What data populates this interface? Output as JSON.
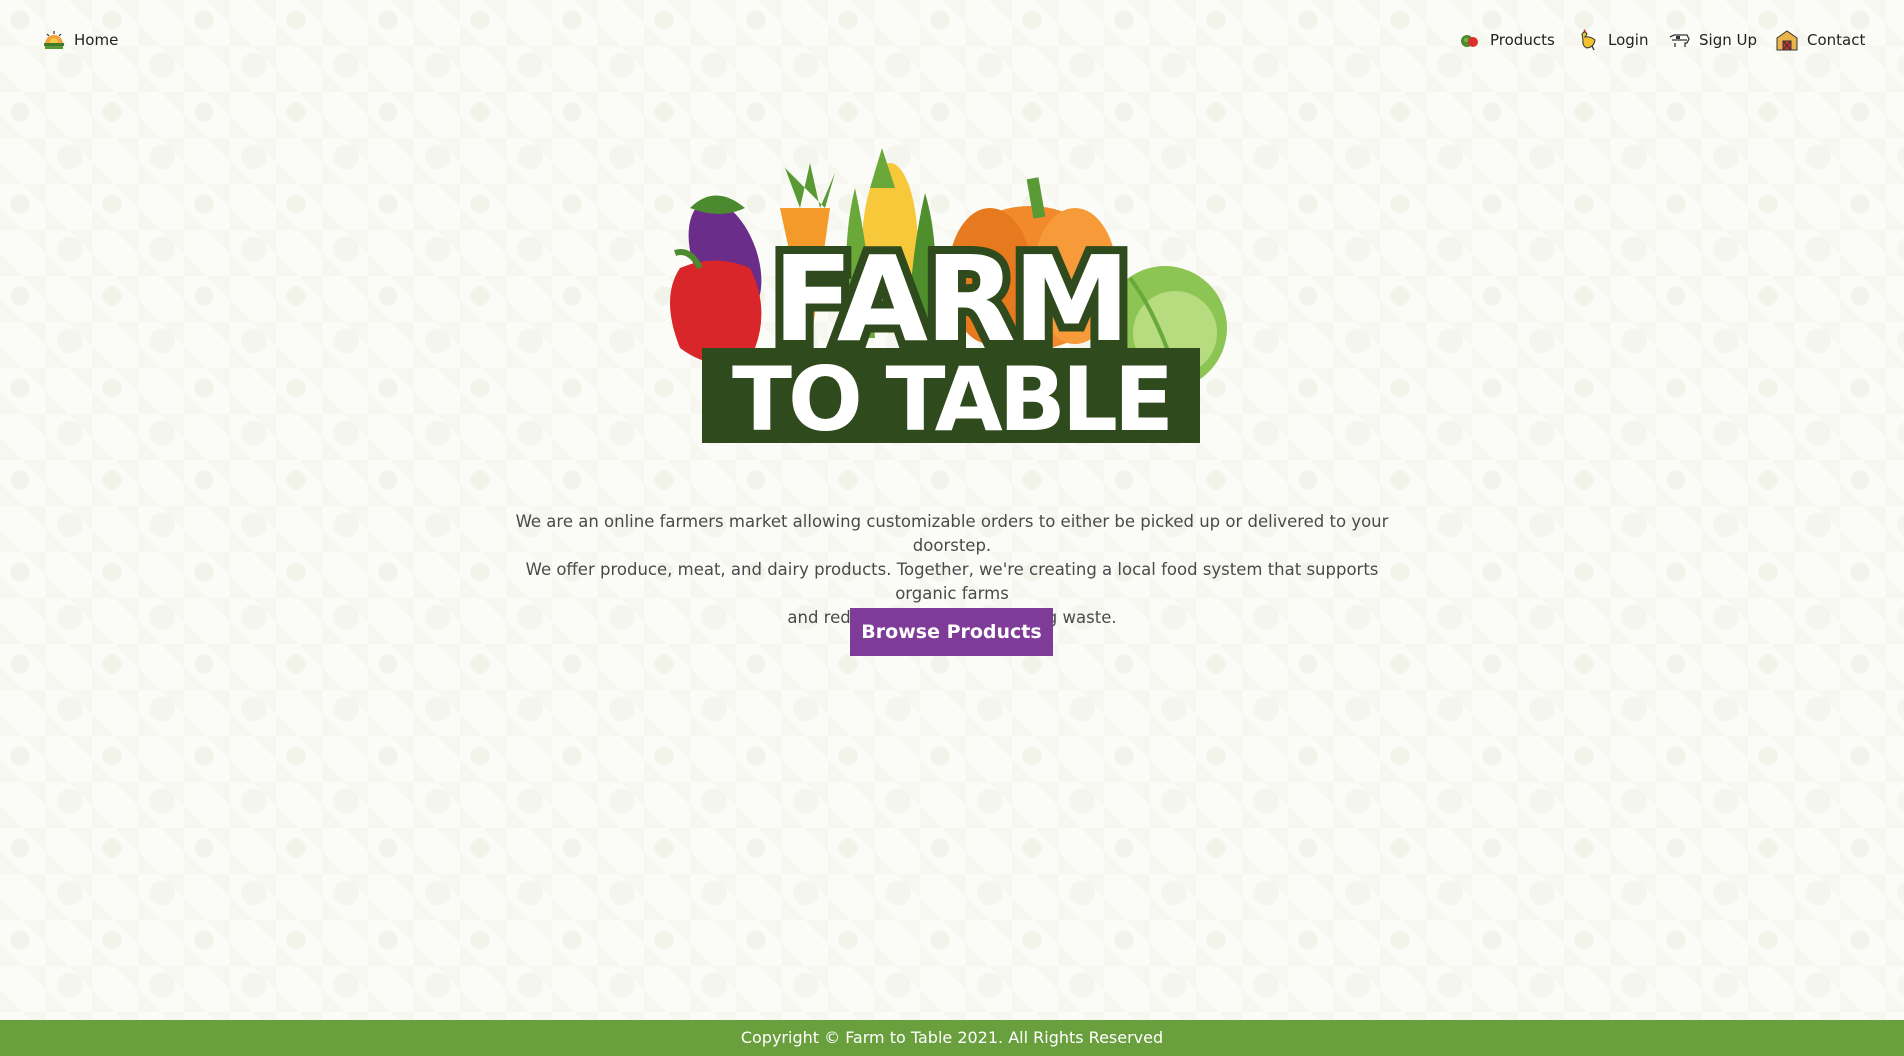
{
  "nav": {
    "home": {
      "label": "Home",
      "icon": "farm-sun-icon"
    },
    "products": {
      "label": "Products",
      "icon": "vegetables-icon"
    },
    "login": {
      "label": "Login",
      "icon": "rooster-icon"
    },
    "signup": {
      "label": "Sign Up",
      "icon": "cow-icon"
    },
    "contact": {
      "label": "Contact",
      "icon": "barn-icon"
    }
  },
  "logo": {
    "line1": "FARM",
    "line2": "TO TABLE"
  },
  "intro": {
    "line1": "We are an online farmers market allowing customizable orders to either be picked up or delivered to your doorstep.",
    "line2": "We offer produce, meat, and dairy products. Together, we're creating a local food system that supports organic farms",
    "line3": "and reduces food and packaging waste."
  },
  "cta": {
    "label": "Browse Products"
  },
  "footer": {
    "copyright": "Copyright © Farm to Table 2021. All Rights Reserved"
  },
  "colors": {
    "brand_purple": "#7e3b98",
    "footer_green": "#6a9f3e",
    "logo_dark_green": "#2f4a1c"
  }
}
